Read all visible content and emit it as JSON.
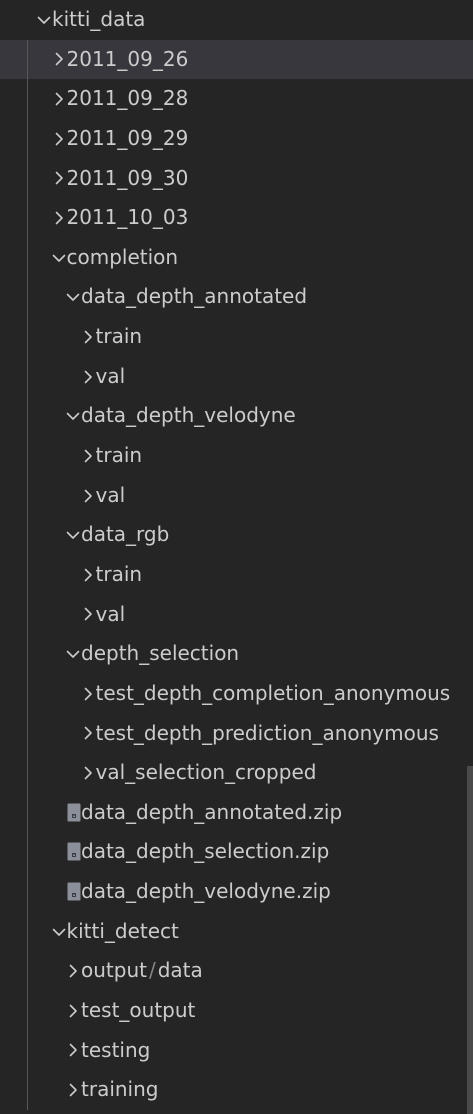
{
  "explorer": {
    "items": [
      {
        "label": "kitti_data",
        "depth": 0,
        "kind": "folder",
        "expanded": true
      },
      {
        "label": "2011_09_26",
        "depth": 1,
        "kind": "folder",
        "expanded": false,
        "selected": true
      },
      {
        "label": "2011_09_28",
        "depth": 1,
        "kind": "folder",
        "expanded": false
      },
      {
        "label": "2011_09_29",
        "depth": 1,
        "kind": "folder",
        "expanded": false
      },
      {
        "label": "2011_09_30",
        "depth": 1,
        "kind": "folder",
        "expanded": false
      },
      {
        "label": "2011_10_03",
        "depth": 1,
        "kind": "folder",
        "expanded": false
      },
      {
        "label": "completion",
        "depth": 1,
        "kind": "folder",
        "expanded": true
      },
      {
        "label": "data_depth_annotated",
        "depth": 2,
        "kind": "folder",
        "expanded": true
      },
      {
        "label": "train",
        "depth": 3,
        "kind": "folder",
        "expanded": false
      },
      {
        "label": "val",
        "depth": 3,
        "kind": "folder",
        "expanded": false
      },
      {
        "label": "data_depth_velodyne",
        "depth": 2,
        "kind": "folder",
        "expanded": true
      },
      {
        "label": "train",
        "depth": 3,
        "kind": "folder",
        "expanded": false
      },
      {
        "label": "val",
        "depth": 3,
        "kind": "folder",
        "expanded": false
      },
      {
        "label": "data_rgb",
        "depth": 2,
        "kind": "folder",
        "expanded": true
      },
      {
        "label": "train",
        "depth": 3,
        "kind": "folder",
        "expanded": false
      },
      {
        "label": "val",
        "depth": 3,
        "kind": "folder",
        "expanded": false
      },
      {
        "label": "depth_selection",
        "depth": 2,
        "kind": "folder",
        "expanded": true
      },
      {
        "label": "test_depth_completion_anonymous",
        "depth": 3,
        "kind": "folder",
        "expanded": false
      },
      {
        "label": "test_depth_prediction_anonymous",
        "depth": 3,
        "kind": "folder",
        "expanded": false
      },
      {
        "label": "val_selection_cropped",
        "depth": 3,
        "kind": "folder",
        "expanded": false
      },
      {
        "label": "data_depth_annotated.zip",
        "depth": 2,
        "kind": "zip"
      },
      {
        "label": "data_depth_selection.zip",
        "depth": 2,
        "kind": "zip"
      },
      {
        "label": "data_depth_velodyne.zip",
        "depth": 2,
        "kind": "zip"
      },
      {
        "label": "kitti_detect",
        "depth": 1,
        "kind": "folder",
        "expanded": true
      },
      {
        "label": "output",
        "label2": "data",
        "separator": "/",
        "depth": 2,
        "kind": "folder",
        "expanded": false
      },
      {
        "label": "test_output",
        "depth": 2,
        "kind": "folder",
        "expanded": false
      },
      {
        "label": "testing",
        "depth": 2,
        "kind": "folder",
        "expanded": false
      },
      {
        "label": "training",
        "depth": 2,
        "kind": "folder",
        "expanded": false
      }
    ]
  },
  "colors": {
    "background": "#252526",
    "text": "#cccccc",
    "selected_row": "#37373d",
    "indent_guide": "#585858",
    "zip_icon": "#8a8f99"
  },
  "icons": {
    "expanded": "chevron-down-icon",
    "collapsed": "chevron-right-icon",
    "zip": "zip-file-icon"
  }
}
